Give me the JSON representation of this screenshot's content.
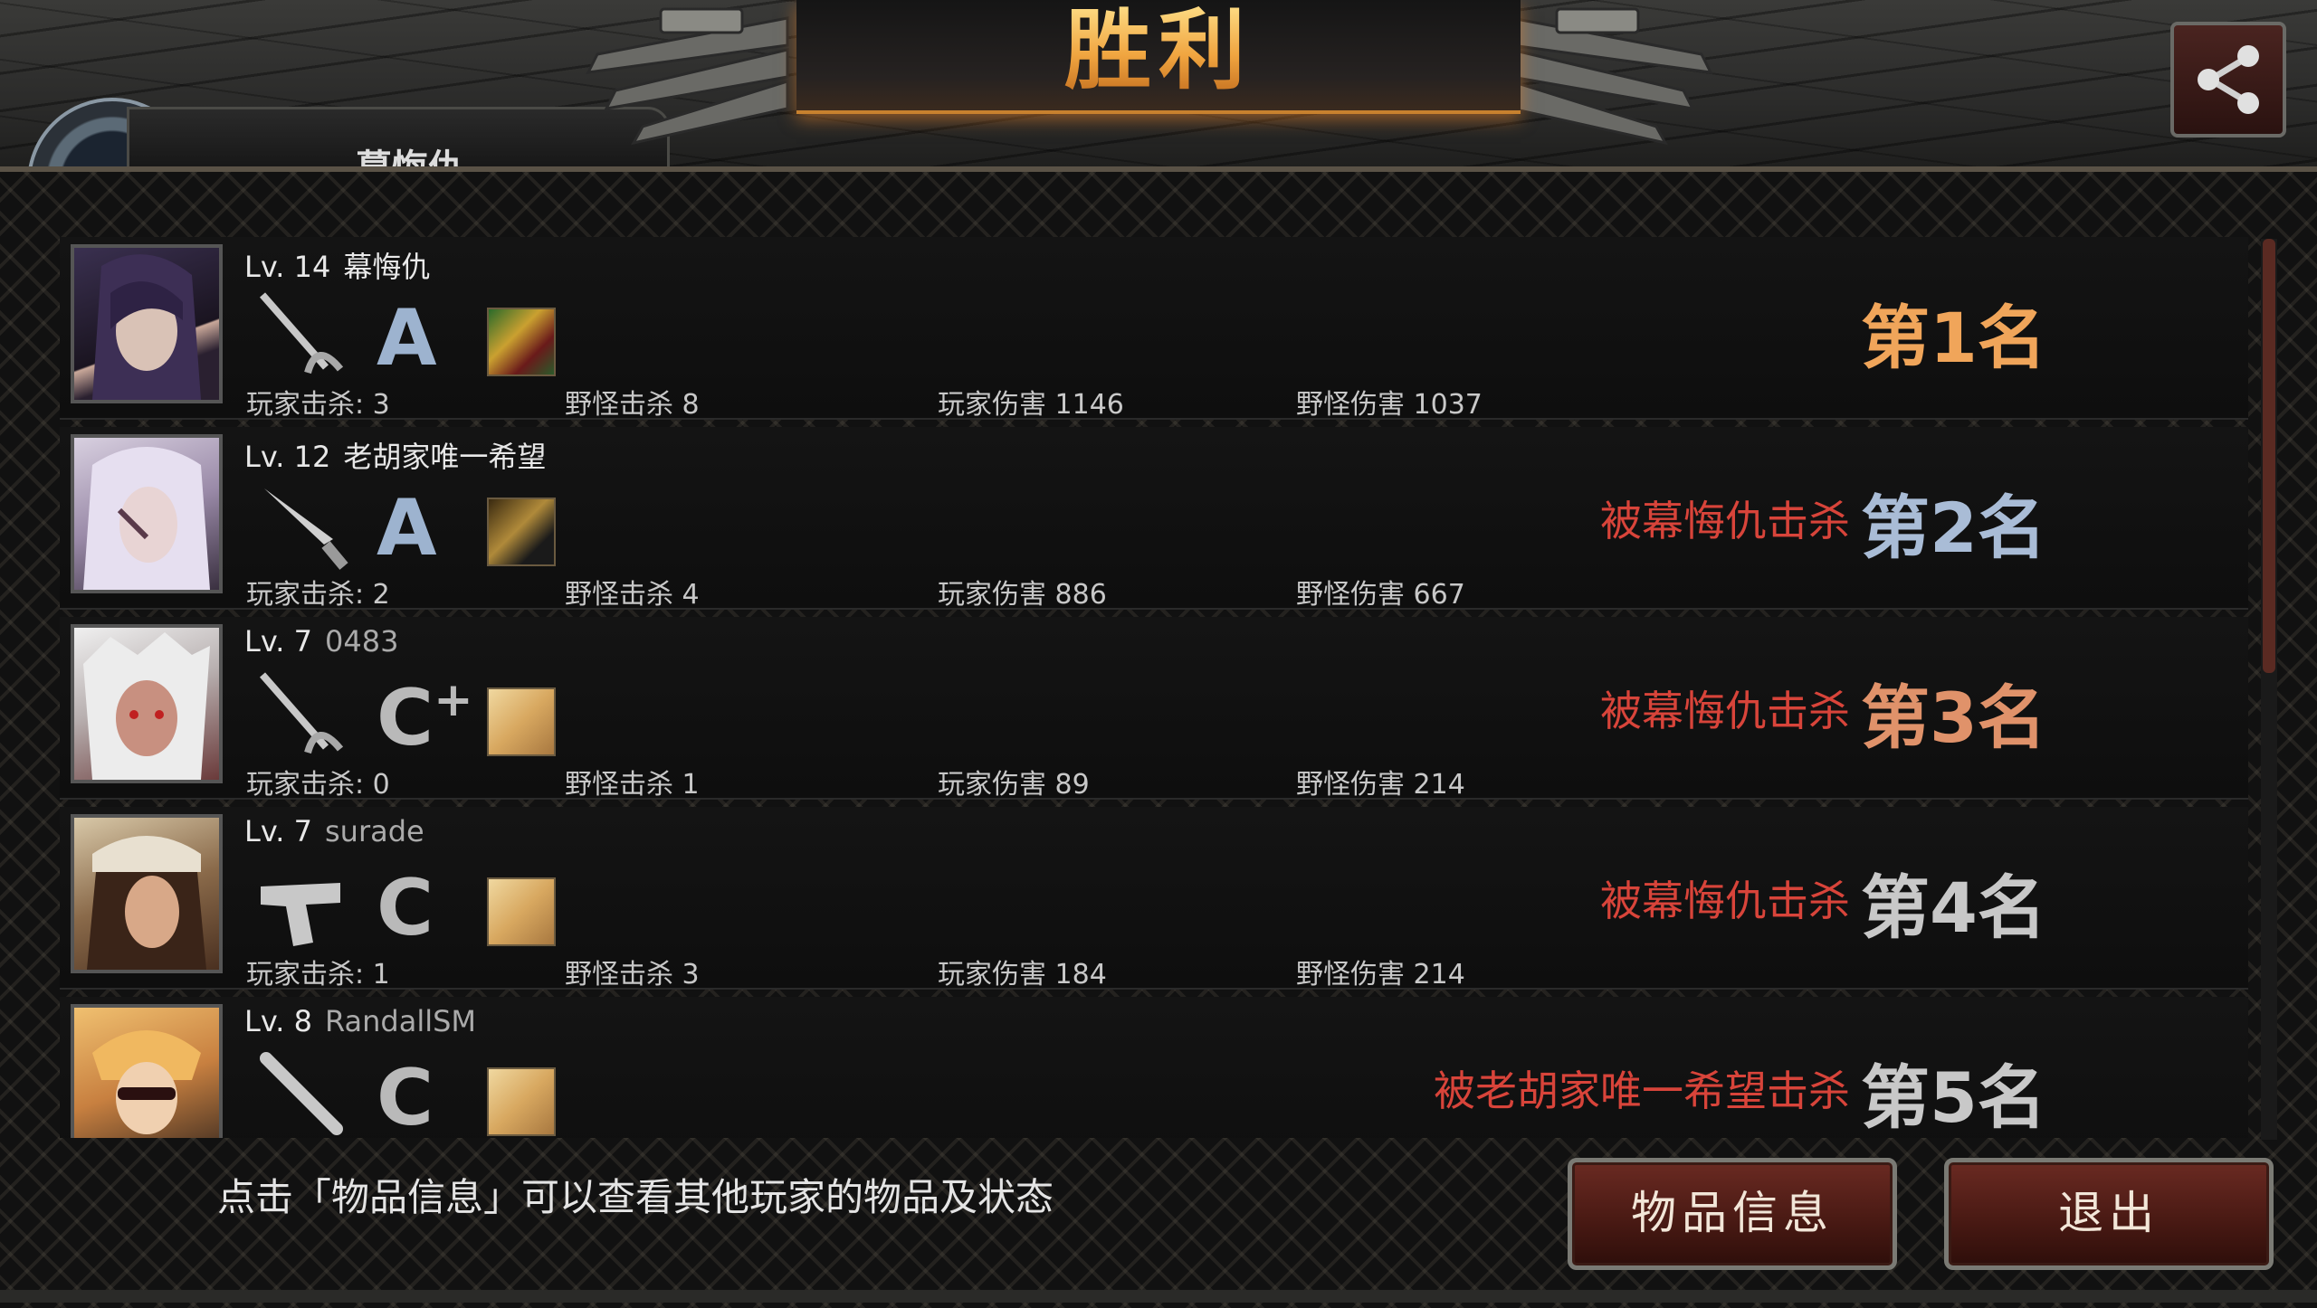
{
  "header": {
    "title": "胜利",
    "player_tab_name": "幕悔仇",
    "share_icon": "share-icon"
  },
  "players": [
    {
      "level": "Lv. 14",
      "name": "幕悔仇",
      "weapon": "sword-icon",
      "grade": "A",
      "grade_plus": "",
      "player_kills": "玩家击杀: 3",
      "monster_kills": "野怪击杀 8",
      "player_damage": "玩家伤害 1146",
      "monster_damage": "野怪伤害 1037",
      "killed_by": "",
      "rank": "第1名",
      "rank_color": "#f0a55a"
    },
    {
      "level": "Lv. 12",
      "name": "老胡家唯一希望",
      "weapon": "knife-icon",
      "grade": "A",
      "grade_plus": "",
      "player_kills": "玩家击杀: 2",
      "monster_kills": "野怪击杀 4",
      "player_damage": "玩家伤害 886",
      "monster_damage": "野怪伤害 667",
      "killed_by": "被幕悔仇击杀",
      "rank": "第2名",
      "rank_color": "#a9bcd6"
    },
    {
      "level": "Lv. 7",
      "name": "0483",
      "weapon": "sword-icon",
      "grade": "C",
      "grade_plus": "+",
      "player_kills": "玩家击杀: 0",
      "monster_kills": "野怪击杀 1",
      "player_damage": "玩家伤害 89",
      "monster_damage": "野怪伤害 214",
      "killed_by": "被幕悔仇击杀",
      "rank": "第3名",
      "rank_color": "#e0926a"
    },
    {
      "level": "Lv. 7",
      "name": "surade",
      "weapon": "pistol-icon",
      "grade": "C",
      "grade_plus": "",
      "player_kills": "玩家击杀: 1",
      "monster_kills": "野怪击杀 3",
      "player_damage": "玩家伤害 184",
      "monster_damage": "野怪伤害 214",
      "killed_by": "被幕悔仇击杀",
      "rank": "第4名",
      "rank_color": "#c8c8c8"
    },
    {
      "level": "Lv. 8",
      "name": "RandallSM",
      "weapon": "bat-icon",
      "grade": "C",
      "grade_plus": "",
      "player_kills": "",
      "monster_kills": "",
      "player_damage": "",
      "monster_damage": "",
      "killed_by": "被老胡家唯一希望击杀",
      "rank": "第5名",
      "rank_color": "#c8c8c8"
    }
  ],
  "footer": {
    "hint": "点击「物品信息」可以查看其他玩家的物品及状态",
    "item_info_button": "物品信息",
    "exit_button": "退出"
  }
}
